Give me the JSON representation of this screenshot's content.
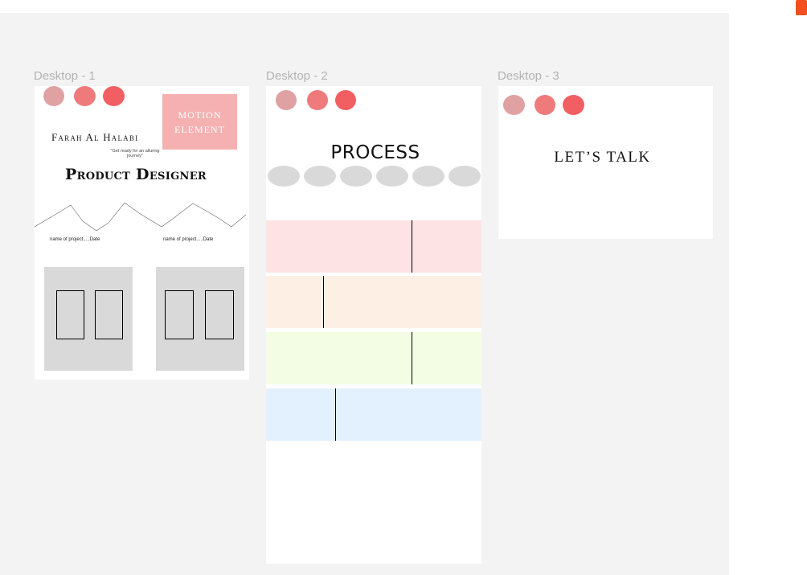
{
  "frames": {
    "desktop1": {
      "label": "Desktop - 1",
      "motion_box": {
        "line1": "MOTION",
        "line2": "ELEMENT"
      },
      "name": "Farah Al Halabi",
      "tagline": "\"Get ready for an alluring journey\"",
      "headline": "Product Designer",
      "projects": [
        {
          "label": "name of project.....Date"
        },
        {
          "label": "name of project.....Date"
        }
      ]
    },
    "desktop2": {
      "label": "Desktop - 2",
      "title": "PROCESS",
      "band_colors": [
        "#fde3e4",
        "#fdefe3",
        "#f3fde3",
        "#e3f0fd"
      ]
    },
    "desktop3": {
      "label": "Desktop - 3",
      "title": "LET’S TALK"
    }
  },
  "colors": {
    "dot_light": "#e0a1a2",
    "dot_mid": "#ef7a7b",
    "dot_bright": "#f25f63",
    "accent_box": "#f5b1b1",
    "figma_orange": "#f24e1e"
  }
}
